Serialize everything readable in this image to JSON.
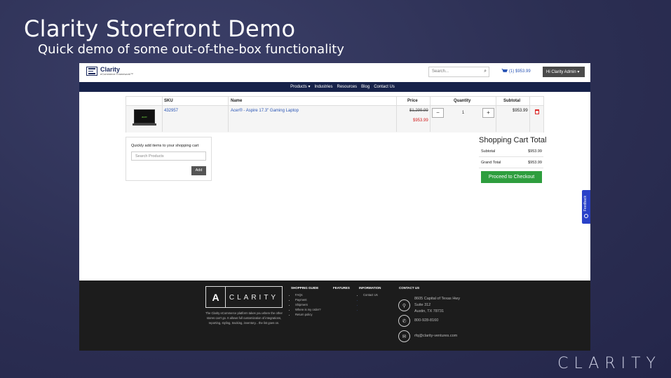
{
  "slide": {
    "title": "Clarity Storefront Demo",
    "subtitle": "Quick demo of some out-of-the-box functionality",
    "corner_logo": "CLARITY"
  },
  "header": {
    "brand": "Clarity",
    "tagline": "eCommerce Framework™",
    "search_placeholder": "Search...",
    "cart_label": "(1) $953.99",
    "user_menu": "Hi Clarity Admin ▾"
  },
  "nav": {
    "items": [
      "Products ▾",
      "Industries",
      "Resources",
      "Blog",
      "Contact Us"
    ]
  },
  "cart": {
    "columns": {
      "sku": "SKU",
      "name": "Name",
      "price": "Price",
      "quantity": "Quantity",
      "subtotal": "Subtotal"
    },
    "item": {
      "image_label": "acer",
      "sku": "432957",
      "name": "Acer® - Aspire 17.3\" Gaming Laptop",
      "original_price": "$1,299.99",
      "sale_price": "$953.99",
      "quantity": "1",
      "minus": "−",
      "plus": "+",
      "subtotal": "$953.99"
    }
  },
  "quick_add": {
    "label": "Quickly add items to your shopping cart",
    "placeholder": "Search Products",
    "button": "Add"
  },
  "totals": {
    "title": "Shopping Cart Total",
    "subtotal_label": "Subtotal",
    "subtotal_value": "$953.99",
    "grand_label": "Grand Total",
    "grand_value": "$953.99",
    "checkout": "Proceed to Checkout"
  },
  "footer": {
    "logo_word": "CLARITY",
    "logo_letter": "A",
    "blurb": "The Clarity eCommerce platform takes you where the other stores can't go. It allows full customization of integrations, reporting, styling, tracking, inventory... the list goes on.",
    "shopping_guide": {
      "title": "SHOPPING GUIDE",
      "items": [
        "FAQs",
        "Payment",
        "Shipment",
        "Where is my order?",
        "Return policy"
      ]
    },
    "features": {
      "title": "FEATURES"
    },
    "information": {
      "title": "INFORMATION",
      "items": [
        "Contact Us",
        "",
        "",
        ""
      ]
    },
    "contact": {
      "title": "CONTACT US",
      "address_1": "8605 Capital of Texas Hwy",
      "address_2": "Suite 312",
      "address_3": "Austin, TX 78731",
      "phone": "800-928-8160",
      "email": "rfq@clarity-ventures.com"
    }
  },
  "feedback": {
    "label": "Feedback"
  },
  "colors": {
    "nav": "#17224a",
    "checkout": "#2e9e3e",
    "sale": "#d22222",
    "link": "#2a55b5",
    "feedback": "#2a41c8"
  }
}
